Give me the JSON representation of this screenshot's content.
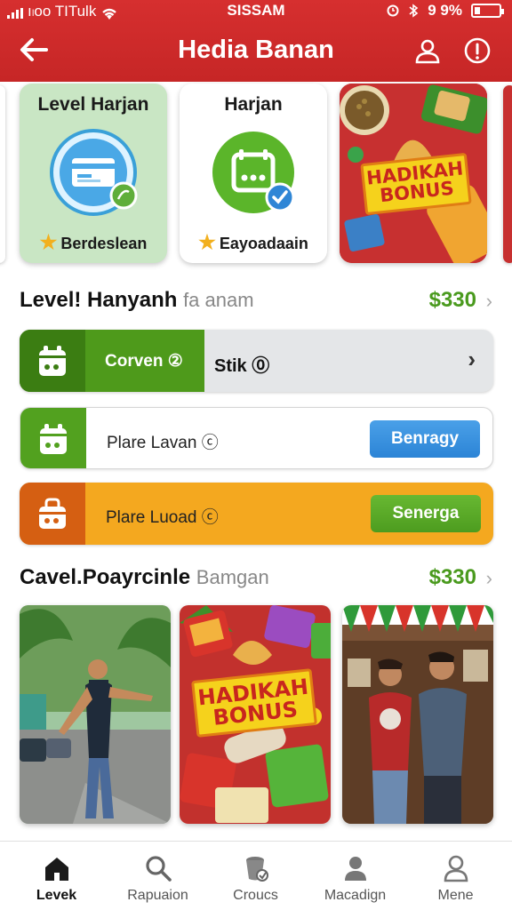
{
  "status_bar": {
    "carrier": "ı၊oo TITulk",
    "center": "SISSAM",
    "battery": "9 9%"
  },
  "header": {
    "title": "Hedia Banan"
  },
  "cards": [
    {
      "title": "Level Harjan",
      "footer": "Berdeslean"
    },
    {
      "title": "Harjan",
      "footer": "Eayoadaain"
    },
    {
      "banner": "HADIKAH BONUS"
    }
  ],
  "section1": {
    "title": "Level! Hanyanh",
    "subtitle": "fa anam",
    "price": "$330"
  },
  "rows": [
    {
      "label": "Corven",
      "mark": "②",
      "label2": "Stik",
      "mark2": "⓪",
      "progress": 0.39
    },
    {
      "label": "Plare Lavan",
      "mark": "ⓒ",
      "button": "Benragy"
    },
    {
      "label": "Plare Luoad",
      "mark": "ⓒ",
      "button": "Senerga"
    }
  ],
  "section2": {
    "title": "Cavel.Poayrcinle",
    "subtitle": "Bamgan",
    "price": "$330"
  },
  "photos": [
    {
      "subject": "man-on-street"
    },
    {
      "banner": "HADIKAH BONUS"
    },
    {
      "subject": "two-men-in-shop"
    }
  ],
  "bottom_nav": [
    {
      "label": "Levek",
      "icon": "home-icon",
      "active": true
    },
    {
      "label": "Rapuaion",
      "icon": "search-icon",
      "active": false
    },
    {
      "label": "Croucs",
      "icon": "bucket-icon",
      "active": false
    },
    {
      "label": "Macadign",
      "icon": "person-icon",
      "active": false
    },
    {
      "label": "Mene",
      "icon": "profile-icon",
      "active": false
    }
  ],
  "colors": {
    "header_red": "#c62626",
    "accent_green": "#4e9a1b",
    "button_blue": "#2c84d6",
    "row_orange": "#f4a81f",
    "price_green": "#4a9a1e"
  }
}
